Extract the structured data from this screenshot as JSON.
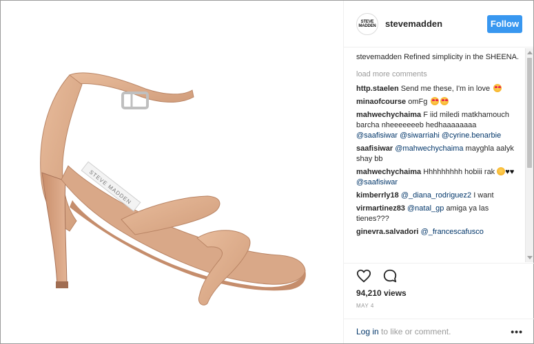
{
  "post": {
    "account": "stevemadden",
    "avatar_text_line1": "STEVE",
    "avatar_text_line2": "MADDEN",
    "follow_label": "Follow",
    "caption_user": "stevemadden",
    "caption_text": "Refined simplicity in the SHEENA.",
    "load_more": "load more comments",
    "views": "94,210 views",
    "date": "MAY 4",
    "login_link": "Log in",
    "login_rest": "to like or comment.",
    "more": "•••",
    "shoe_label": "STEVE MADDEN"
  },
  "comments": [
    {
      "user": "http.staelen",
      "text": "Send me these, I'm in love"
    },
    {
      "user": "minaofcourse",
      "text": "omFg"
    },
    {
      "user": "mahwechychaima",
      "text": "F iid miledi matkhamouch barcha nheeeeeeeb hedhaaaaaaaa",
      "mentions": [
        "@saafisiwar",
        "@siwarriahi",
        "@cyrine.benarbie"
      ]
    },
    {
      "user": "saafisiwar",
      "mention": "@mahwechychaima",
      "text": "mayghla aalyk shay bb"
    },
    {
      "user": "mahwechychaima",
      "text": "Hhhhhhhhh hobiii rak",
      "mention": "@saafisiwar"
    },
    {
      "user": "kimberrly18",
      "mention": "@_diana_rodriguez2",
      "text": "I want"
    },
    {
      "user": "virmartinez83",
      "mention": "@natal_gp",
      "text": "amiga ya las tienes???"
    },
    {
      "user": "ginevra.salvadori",
      "mention": "@_francescafusco"
    }
  ],
  "colors": {
    "follow_button": "#3897f0",
    "mention": "#003569",
    "muted": "#999999"
  },
  "icons": [
    "heart-icon",
    "comment-icon",
    "more-options-icon"
  ]
}
